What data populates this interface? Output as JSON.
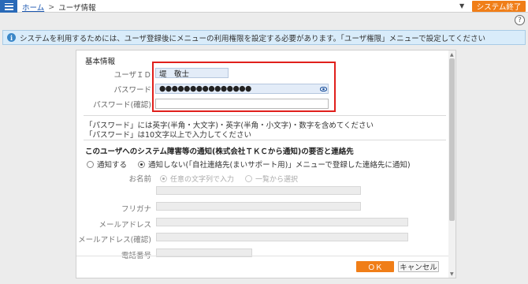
{
  "topbar": {
    "menu_icon": "hamburger-menu-icon",
    "breadcrumb_home": "ホーム",
    "breadcrumb_separator": ">",
    "breadcrumb_current": "ユーザ情報",
    "dropdown_arrow": "▼",
    "exit_button": "システム終了"
  },
  "help": {
    "icon": "help-icon",
    "label": "?"
  },
  "info_banner": {
    "icon": "info-icon",
    "icon_glyph": "i",
    "text": "システムを利用するためには、ユーザ登録後にメニューの利用権限を設定する必要があります。「ユーザ権限」メニューで設定してください"
  },
  "form": {
    "section_title": "基本情報",
    "user_id_label": "ユーザＩＤ",
    "user_id_value": "堤　敬士",
    "password_label": "パスワード",
    "password_value": "●●●●●●●●●●●●●●●",
    "password_toggle_icon": "eye-icon",
    "password_toggle_glyph": "👁",
    "password_confirm_label": "パスワード(確認)",
    "password_confirm_value": ""
  },
  "notes": {
    "line1": "「パスワード」には英字(半角・大文字)・英字(半角・小文字)・数字を含めてください",
    "line2": "「パスワード」は10文字以上で入力してください"
  },
  "notification": {
    "title": "このユーザへのシステム障害等の通知(株式会社ＴＫＣから通知)の要否と連絡先",
    "option_notify": "通知する",
    "option_no_notify": "通知しない(「自社連絡先(まいサポート用)」メニューで登録した連絡先に通知)",
    "selected": "通知しない",
    "name_label": "お名前",
    "name_option_free": "任意の文字列で入力",
    "name_option_list": "一覧から選択",
    "furigana_label": "フリガナ",
    "email_label": "メールアドレス",
    "email_confirm_label": "メールアドレス(確認)",
    "phone_label": "電話番号"
  },
  "buttons": {
    "ok": "ＯＫ",
    "cancel": "キャンセル"
  },
  "colors": {
    "accent_orange": "#f07e18",
    "menu_blue": "#2a6ab8",
    "highlight_red": "#e0201c",
    "info_bg": "#d9ecfa"
  }
}
